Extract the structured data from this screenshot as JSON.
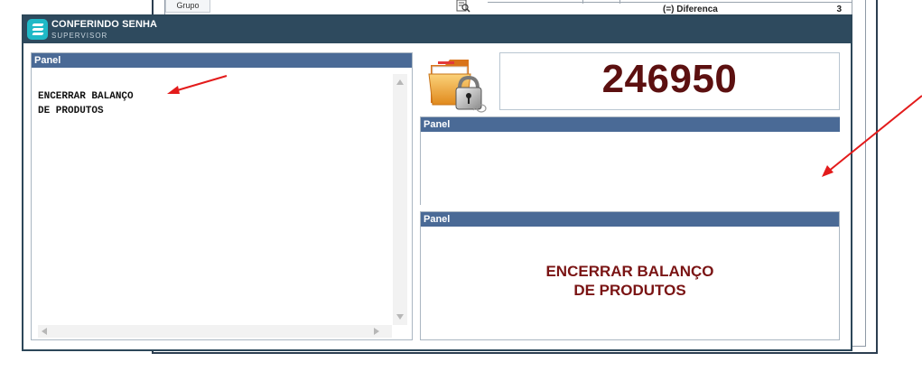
{
  "background_app": {
    "tab_label": "Grupo",
    "difference_label": "(=) Diferenca",
    "difference_value": "3",
    "search_icon": "search-list-icon"
  },
  "dialog": {
    "title": "CONFERINDO SENHA",
    "subtitle": "SUPERVISOR",
    "logo_icon": "app-logo-icon",
    "left_panel": {
      "header": "Panel",
      "memo_lines": [
        "ENCERRAR BALANÇO",
        "DE PRODUTOS"
      ]
    },
    "folder_lock_icon": "folder-lock-icon",
    "code_value": "246950",
    "middle_panel": {
      "header": "Panel"
    },
    "bottom_panel": {
      "header": "Panel",
      "message_lines": [
        "ENCERRAR BALANÇO",
        "DE PRODUTOS"
      ]
    }
  },
  "annotations": {
    "arrow_color": "#e31b1b"
  },
  "colors": {
    "titlebar": "#2e4a5e",
    "panel_header": "#4a6a96",
    "code_text": "#5c1010",
    "message_text": "#7a1414"
  }
}
